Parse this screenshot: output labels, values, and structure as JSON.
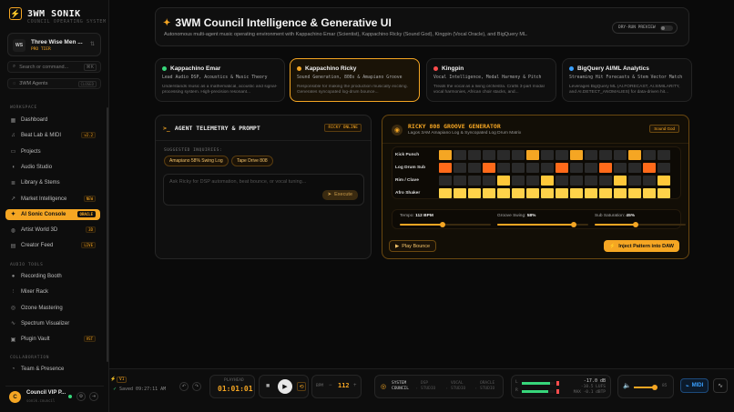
{
  "brand": {
    "title": "3WM SONIK",
    "subtitle": "COUNCIL OPERATING SYSTEM",
    "logo_icon": "bolt-icon"
  },
  "workspace": {
    "badge": "WS",
    "name": "Three Wise Men ...",
    "tier": "PRO TIER"
  },
  "search": {
    "placeholder": "Search or command...",
    "shortcut": "⌘K"
  },
  "agents_toggle": {
    "label": "3WM Agents",
    "state": "CLOSED"
  },
  "sidebar": {
    "workspace_title": "WORKSPACE",
    "workspace_items": [
      {
        "label": "Dashboard",
        "icon": "grid-icon",
        "tag": ""
      },
      {
        "label": "Beat Lab & MIDI",
        "icon": "piano-icon",
        "tag": "v2.2"
      },
      {
        "label": "Projects",
        "icon": "folder-icon",
        "tag": ""
      },
      {
        "label": "Audio Studio",
        "icon": "speaker-icon",
        "tag": ""
      },
      {
        "label": "Library & Stems",
        "icon": "layers-icon",
        "tag": ""
      },
      {
        "label": "Market Intelligence",
        "icon": "trend-icon",
        "tag": "NEW"
      },
      {
        "label": "AI Sonic Console",
        "icon": "spark-icon",
        "tag": "ORACLE"
      },
      {
        "label": "Artist World 3D",
        "icon": "globe-icon",
        "tag": "3D"
      },
      {
        "label": "Creator Feed",
        "icon": "feed-icon",
        "tag": "LIVE"
      }
    ],
    "tools_title": "AUDIO TOOLS",
    "tools_items": [
      {
        "label": "Recording Booth",
        "icon": "mic-icon",
        "tag": ""
      },
      {
        "label": "Mixer Rack",
        "icon": "sliders-icon",
        "tag": ""
      },
      {
        "label": "Ozone Mastering",
        "icon": "disc-icon",
        "tag": ""
      },
      {
        "label": "Spectrum Visualizer",
        "icon": "wave-icon",
        "tag": ""
      },
      {
        "label": "Plugin Vault",
        "icon": "box-icon",
        "tag": "VST"
      }
    ],
    "collab_title": "COLLABORATION",
    "collab_items": [
      {
        "label": "Team & Presence",
        "icon": "users-icon",
        "tag": ""
      }
    ]
  },
  "user": {
    "initial": "C",
    "name": "Council VIP P...",
    "sub": "sonik.council"
  },
  "header": {
    "title": "3WM Council Intelligence & Generative UI",
    "subtitle": "Autonomous multi-agent music operating environment with Kappachino Emar (Scientist), Kappachino Ricky (Sound God), Kingpin (Vocal Oracle), and BigQuery ML.",
    "dry_run_label": "DRY-RUN PREVIEW"
  },
  "agents": [
    {
      "name": "Kappachino Emar",
      "color": "#37d67a",
      "role": "Lead Audio DSP, Acoustics & Music Theory",
      "desc": "Understands music as a mathematical, acoustic and signal-processing system. High-precision resonant..."
    },
    {
      "name": "Kappachino Ricky",
      "color": "#f5a623",
      "role": "Sound Generation, 808s & Amapiano Groove",
      "desc": "Responsible for making the production musically exciting. Generates syncopated log-drum bounce..."
    },
    {
      "name": "Kingpin",
      "color": "#ff4d4d",
      "role": "Vocal Intelligence, Modal Harmony & Pitch",
      "desc": "Treats the vocal as a living orchestra. Crafts 3-part modal vocal harmonies, African choir stacks, and..."
    },
    {
      "name": "BigQuery AI/ML Analytics",
      "color": "#3aa0ff",
      "role": "Streaming Hit Forecasts & Stem Vector Match",
      "desc": "Leverages BigQuery ML (AI.FORECAST, AI.SIMILARITY, and AI.DETECT_ANOMALIES) for data-driven hit..."
    }
  ],
  "telemetry": {
    "title": "AGENT TELEMETRY & PROMPT",
    "badge": "RICKY ONLINE",
    "suggested_label": "SUGGESTED INQUIRIES:",
    "chips": [
      "Amapiano 58% Swing Log",
      "Tape Drive 808"
    ],
    "input_placeholder": "Ask Ricky for DSP automation, beat bounce, or vocal tuning...",
    "execute_label": "Execute"
  },
  "groove": {
    "title": "RICKY 808 GROOVE GENERATOR",
    "subtitle": "Lagos 3AM Amapiano Log & Syncopated Log Drum Matrix",
    "badge": "Sound God",
    "tracks": [
      {
        "name": "Kick Punch",
        "color": "#f5a623",
        "steps": [
          1,
          0,
          0,
          0,
          0,
          0,
          1,
          0,
          0,
          1,
          0,
          0,
          0,
          1,
          0,
          0
        ]
      },
      {
        "name": "Log Drum Sub",
        "color": "#ff6a1a",
        "steps": [
          1,
          0,
          0,
          1,
          0,
          0,
          0,
          0,
          1,
          0,
          0,
          1,
          0,
          0,
          1,
          0
        ]
      },
      {
        "name": "Rim / Clave",
        "color": "#ffc83a",
        "steps": [
          0,
          0,
          0,
          0,
          1,
          0,
          0,
          1,
          0,
          0,
          0,
          0,
          1,
          0,
          0,
          1
        ]
      },
      {
        "name": "Afro Shaker",
        "color": "#ffd24a",
        "steps": [
          1,
          1,
          1,
          1,
          1,
          1,
          1,
          1,
          1,
          1,
          1,
          1,
          1,
          1,
          1,
          1
        ]
      }
    ],
    "params": [
      {
        "label": "Tempo:",
        "value": "112 BPM",
        "fraction": 0.47
      },
      {
        "label": "Groove Swing:",
        "value": "58%",
        "fraction": 0.84
      },
      {
        "label": "Sub Saturation:",
        "value": "45%",
        "fraction": 0.45
      }
    ],
    "play_label": "Play Bounce",
    "inject_label": "Inject Pattern into DAW"
  },
  "transport": {
    "version": "V1",
    "saved": "Saved 09:27:11 AM",
    "time_label": "PLAYHEAD",
    "time": "01:01:01",
    "bpm_label": "BPM",
    "bpm": "112",
    "council_label": "SYSTEM COUNCIL",
    "steps": [
      "DSP STUDIO",
      "VOCAL STUDIO",
      "ORACLE STUDIO"
    ],
    "db_value": "-17.0 dB",
    "lufs": "-10.5 LUFS",
    "peak": "MAX -0.1 dBTP",
    "range": "-14.5",
    "volume": "85",
    "midi_label": "MIDI"
  }
}
